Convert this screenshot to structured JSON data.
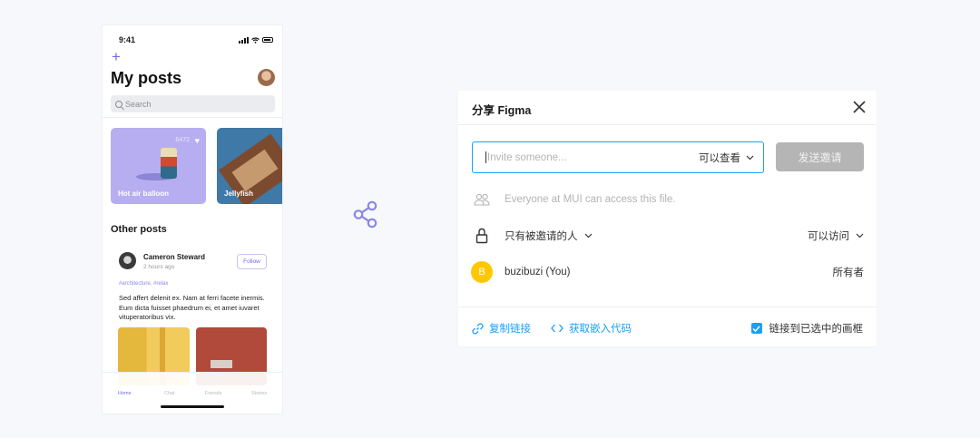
{
  "phone": {
    "status_time": "9:41",
    "plus": "+",
    "title": "My posts",
    "search_placeholder": "Search",
    "cards": [
      {
        "label": "Hot air balloon",
        "likes": "6472"
      },
      {
        "label": "Jellyfish"
      }
    ],
    "other_posts_title": "Other posts",
    "post": {
      "author": "Cameron Steward",
      "time": "2 hours ago",
      "follow_label": "Follow",
      "tags": "#architecture, #relax",
      "body": "Sed affert delenit ex. Nam at ferri facete inermis. Eum dicta fuisset phaedrum ei, et amet iuvaret vituperatoribus vix."
    },
    "tabs": [
      "Home",
      "Chat",
      "Friends",
      "Stories"
    ],
    "accent_color": "#6f6ce8"
  },
  "share_icon": "share-icon",
  "dialog": {
    "title": "分享 Figma",
    "invite_placeholder": "Invite someone...",
    "permission_select": "可以查看",
    "send_button": "发送邀请",
    "everyone_text": "Everyone at MUI can access this file.",
    "access_label": "只有被邀请的人",
    "access_permission": "可以访问",
    "user": {
      "initial": "B",
      "name": "buzibuzi (You)",
      "role": "所有者"
    },
    "copy_link": "复制链接",
    "embed_code": "获取嵌入代码",
    "link_frame_label": "链接到已选中的画框",
    "link_frame_checked": true,
    "accent_color": "#18a0fb",
    "avatar_color": "#ffc700"
  }
}
